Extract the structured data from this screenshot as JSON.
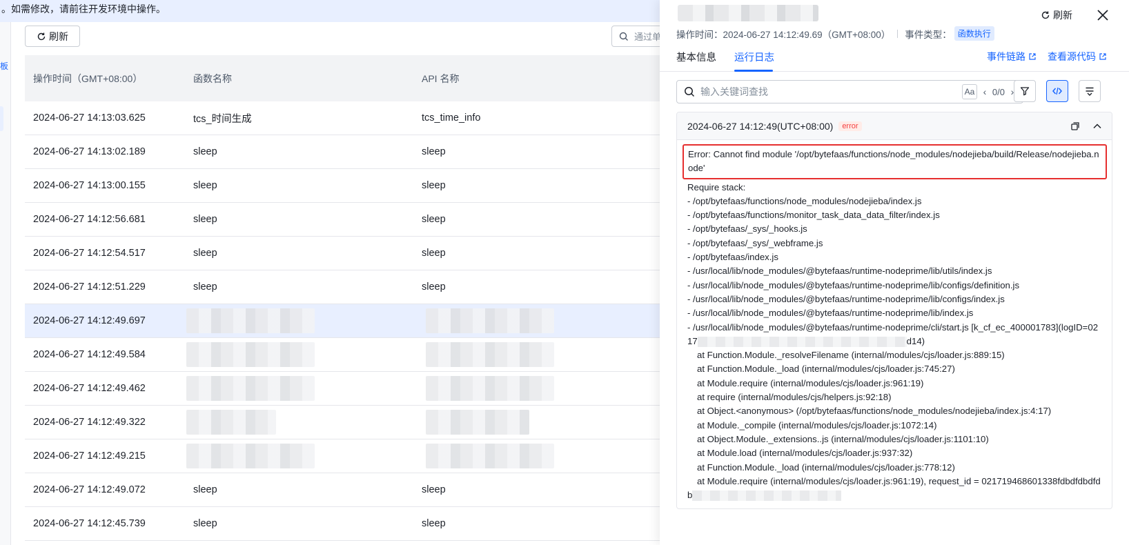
{
  "notice": "。如需修改，请前往开发环境中操作。",
  "leftbar_mark": "板",
  "toolbar": {
    "refresh_label": "刷新",
    "search_placeholder": "通过单"
  },
  "table": {
    "headers": [
      "操作时间（GMT+08:00）",
      "函数名称",
      "API 名称"
    ],
    "rows": [
      {
        "time": "2024-06-27 14:13:03.625",
        "func": "tcs_时间生成",
        "api": "tcs_time_info",
        "active": false
      },
      {
        "time": "2024-06-27 14:13:02.189",
        "func": "sleep",
        "api": "sleep",
        "active": false
      },
      {
        "time": "2024-06-27 14:13:00.155",
        "func": "sleep",
        "api": "sleep",
        "active": false
      },
      {
        "time": "2024-06-27 14:12:56.681",
        "func": "sleep",
        "api": "sleep",
        "active": false
      },
      {
        "time": "2024-06-27 14:12:54.517",
        "func": "sleep",
        "api": "sleep",
        "active": false
      },
      {
        "time": "2024-06-27 14:12:51.229",
        "func": "sleep",
        "api": "sleep",
        "active": false
      },
      {
        "time": "2024-06-27 14:12:49.697",
        "func": "",
        "api": "",
        "active": true
      },
      {
        "time": "2024-06-27 14:12:49.584",
        "func": "",
        "api": "",
        "active": false
      },
      {
        "time": "2024-06-27 14:12:49.462",
        "func": "",
        "api": "",
        "active": false
      },
      {
        "time": "2024-06-27 14:12:49.322",
        "func": "",
        "api": "",
        "active": false
      },
      {
        "time": "2024-06-27 14:12:49.215",
        "func": "",
        "api": "",
        "active": false
      },
      {
        "time": "2024-06-27 14:12:49.072",
        "func": "sleep",
        "api": "sleep",
        "active": false
      },
      {
        "time": "2024-06-27 14:12:45.739",
        "func": "sleep",
        "api": "sleep",
        "active": false
      }
    ]
  },
  "drawer": {
    "refresh_label": "刷新",
    "meta_time_label": "操作时间：",
    "meta_time_value": "2024-06-27 14:12:49.69（GMT+08:00）",
    "meta_type_label": "事件类型：",
    "meta_type_badge": "函数执行",
    "tabs": [
      "基本信息",
      "运行日志"
    ],
    "active_tab": "运行日志",
    "link_trace": "事件链路",
    "link_source": "查看源代码",
    "search_placeholder": "输入关键词查找",
    "case_label": "Aa",
    "match_counter": "0/0",
    "log": {
      "timestamp": "2024-06-27 14:12:49(UTC+08:00)",
      "level_badge": "error",
      "error_line": "Error: Cannot find module '/opt/bytefaas/functions/node_modules/nodejieba/build/Release/nodejieba.node'",
      "stack_lines": [
        "Require stack:",
        "- /opt/bytefaas/functions/node_modules/nodejieba/index.js",
        "- /opt/bytefaas/functions/monitor_task_data_data_filter/index.js",
        "- /opt/bytefaas/_sys/_hooks.js",
        "- /opt/bytefaas/_sys/_webframe.js",
        "- /opt/bytefaas/index.js",
        "- /usr/local/lib/node_modules/@bytefaas/runtime-nodeprime/lib/utils/index.js",
        "- /usr/local/lib/node_modules/@bytefaas/runtime-nodeprime/lib/configs/definition.js",
        "- /usr/local/lib/node_modules/@bytefaas/runtime-nodeprime/lib/configs/index.js",
        "- /usr/local/lib/node_modules/@bytefaas/runtime-nodeprime/lib/index.js",
        "- /usr/local/lib/node_modules/@bytefaas/runtime-nodeprime/cli/start.js [k_cf_ec_400001783](logID=02"
      ],
      "logid_prefix": "17",
      "logid_suffix": "d14)",
      "at_lines": [
        "at Function.Module._resolveFilename (internal/modules/cjs/loader.js:889:15)",
        "at Function.Module._load (internal/modules/cjs/loader.js:745:27)",
        "at Module.require (internal/modules/cjs/loader.js:961:19)",
        "at require (internal/modules/cjs/helpers.js:92:18)",
        "at Object.<anonymous> (/opt/bytefaas/functions/node_modules/nodejieba/index.js:4:17)",
        "at Module._compile (internal/modules/cjs/loader.js:1072:14)",
        "at Object.Module._extensions..js (internal/modules/cjs/loader.js:1101:10)",
        "at Module.load (internal/modules/cjs/loader.js:937:32)",
        "at Function.Module._load (internal/modules/cjs/loader.js:778:12)",
        "at Module.require (internal/modules/cjs/loader.js:961:19), request_id = 021719468601338fdbdfdbdfd"
      ],
      "last_prefix": "b"
    }
  },
  "colors": {
    "accent": "#1664ff",
    "error": "#f53f3f",
    "highlight_box": "#e62e2e",
    "active_row": "#e8efff"
  }
}
